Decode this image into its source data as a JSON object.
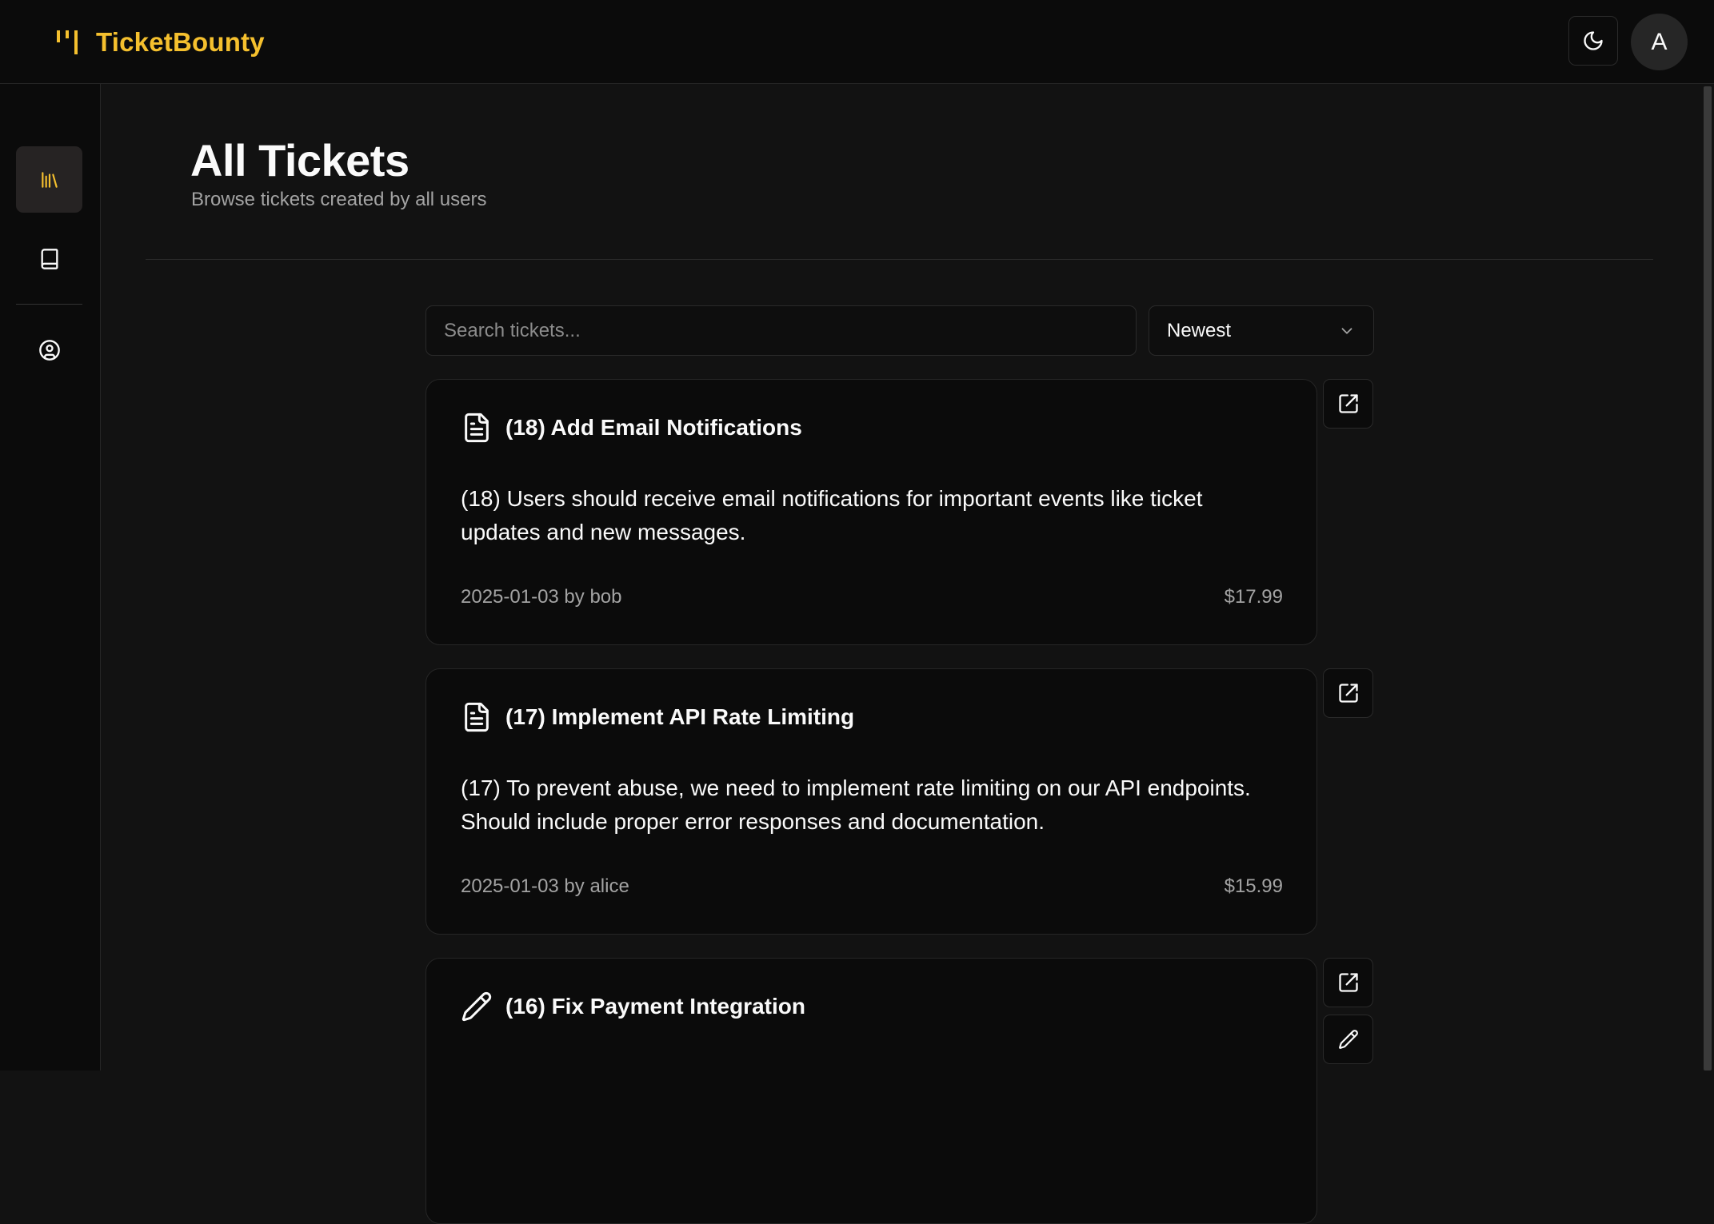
{
  "app": {
    "brand": "TicketBounty",
    "avatar_initial": "A",
    "accent_color": "#f5c02e"
  },
  "sidebar": {
    "items": [
      {
        "name": "all-tickets",
        "icon": "library-icon",
        "active": true
      },
      {
        "name": "my-tickets",
        "icon": "book-icon",
        "active": false
      },
      {
        "name": "account",
        "icon": "user-circle-icon",
        "active": false
      }
    ]
  },
  "page": {
    "title": "All Tickets",
    "subtitle": "Browse tickets created by all users"
  },
  "search": {
    "placeholder": "Search tickets..."
  },
  "sort": {
    "selected": "Newest"
  },
  "tickets": [
    {
      "title": "(18) Add Email Notifications",
      "description": "(18) Users should receive email notifications for important events like ticket updates and new messages.",
      "meta": "2025-01-03 by bob",
      "price": "$17.99",
      "status_icon": "file-text-icon"
    },
    {
      "title": "(17) Implement API Rate Limiting",
      "description": "(17) To prevent abuse, we need to implement rate limiting on our API endpoints. Should include proper error responses and documentation.",
      "meta": "2025-01-03 by alice",
      "price": "$15.99",
      "status_icon": "file-text-icon"
    },
    {
      "title": "(16) Fix Payment Integration",
      "description": "",
      "meta": "",
      "price": "",
      "status_icon": "pencil-icon"
    }
  ]
}
